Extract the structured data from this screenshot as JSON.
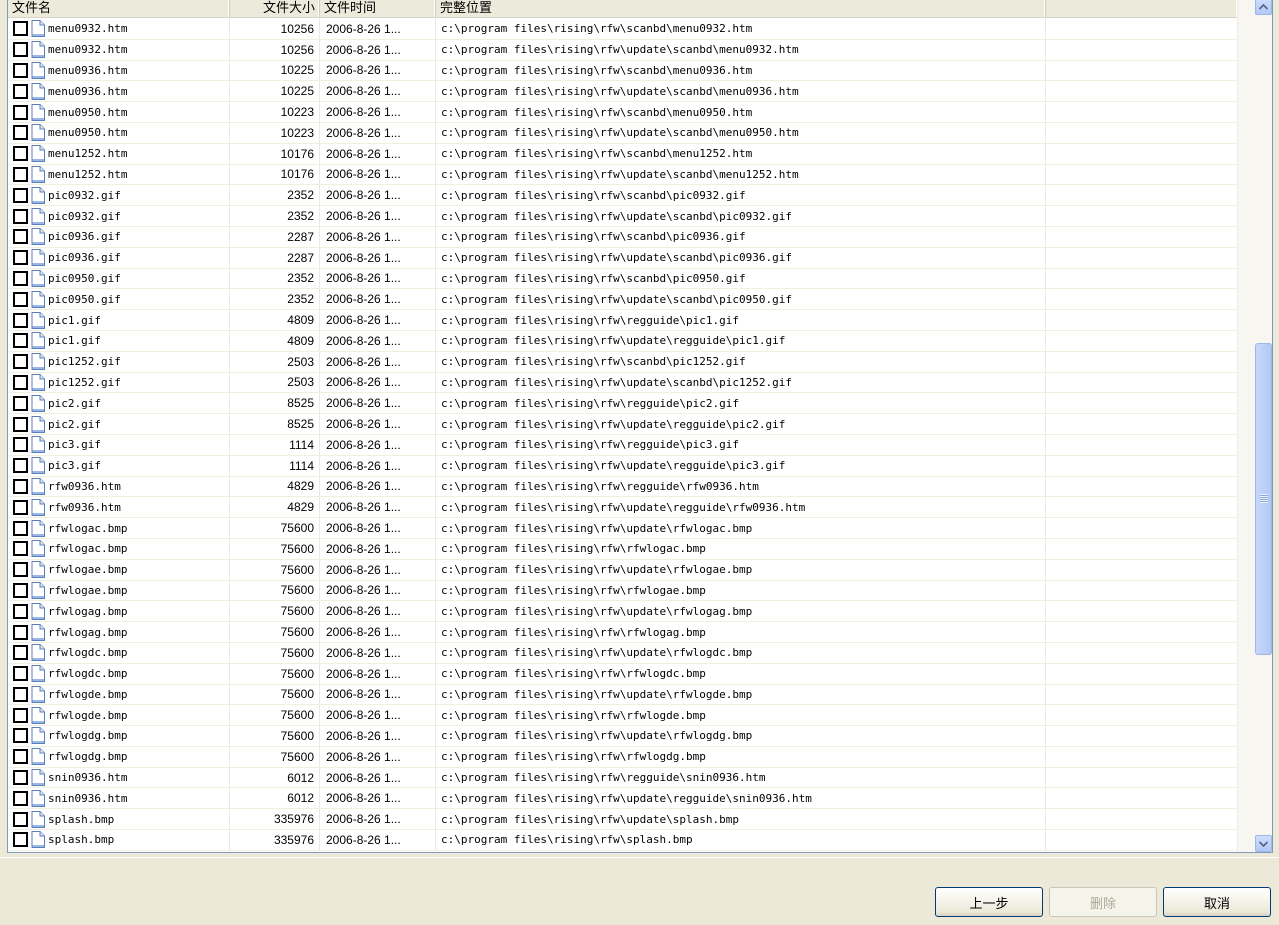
{
  "headers": {
    "name": "文件名",
    "size": "文件大小",
    "time": "文件时间",
    "path": "完整位置"
  },
  "icons": {
    "checkbox": "checkbox-unchecked",
    "file": "file-icon",
    "scroll_up": "scroll-up-arrow-icon",
    "scroll_down": "scroll-down-arrow-icon"
  },
  "rows": [
    {
      "name": "menu0932.htm",
      "size": "10256",
      "time": "2006-8-26 1...",
      "path": "c:\\program files\\rising\\rfw\\scanbd\\menu0932.htm"
    },
    {
      "name": "menu0932.htm",
      "size": "10256",
      "time": "2006-8-26 1...",
      "path": "c:\\program files\\rising\\rfw\\update\\scanbd\\menu0932.htm"
    },
    {
      "name": "menu0936.htm",
      "size": "10225",
      "time": "2006-8-26 1...",
      "path": "c:\\program files\\rising\\rfw\\scanbd\\menu0936.htm"
    },
    {
      "name": "menu0936.htm",
      "size": "10225",
      "time": "2006-8-26 1...",
      "path": "c:\\program files\\rising\\rfw\\update\\scanbd\\menu0936.htm"
    },
    {
      "name": "menu0950.htm",
      "size": "10223",
      "time": "2006-8-26 1...",
      "path": "c:\\program files\\rising\\rfw\\scanbd\\menu0950.htm"
    },
    {
      "name": "menu0950.htm",
      "size": "10223",
      "time": "2006-8-26 1...",
      "path": "c:\\program files\\rising\\rfw\\update\\scanbd\\menu0950.htm"
    },
    {
      "name": "menu1252.htm",
      "size": "10176",
      "time": "2006-8-26 1...",
      "path": "c:\\program files\\rising\\rfw\\scanbd\\menu1252.htm"
    },
    {
      "name": "menu1252.htm",
      "size": "10176",
      "time": "2006-8-26 1...",
      "path": "c:\\program files\\rising\\rfw\\update\\scanbd\\menu1252.htm"
    },
    {
      "name": "pic0932.gif",
      "size": "2352",
      "time": "2006-8-26 1...",
      "path": "c:\\program files\\rising\\rfw\\scanbd\\pic0932.gif"
    },
    {
      "name": "pic0932.gif",
      "size": "2352",
      "time": "2006-8-26 1...",
      "path": "c:\\program files\\rising\\rfw\\update\\scanbd\\pic0932.gif"
    },
    {
      "name": "pic0936.gif",
      "size": "2287",
      "time": "2006-8-26 1...",
      "path": "c:\\program files\\rising\\rfw\\scanbd\\pic0936.gif"
    },
    {
      "name": "pic0936.gif",
      "size": "2287",
      "time": "2006-8-26 1...",
      "path": "c:\\program files\\rising\\rfw\\update\\scanbd\\pic0936.gif"
    },
    {
      "name": "pic0950.gif",
      "size": "2352",
      "time": "2006-8-26 1...",
      "path": "c:\\program files\\rising\\rfw\\scanbd\\pic0950.gif"
    },
    {
      "name": "pic0950.gif",
      "size": "2352",
      "time": "2006-8-26 1...",
      "path": "c:\\program files\\rising\\rfw\\update\\scanbd\\pic0950.gif"
    },
    {
      "name": "pic1.gif",
      "size": "4809",
      "time": "2006-8-26 1...",
      "path": "c:\\program files\\rising\\rfw\\regguide\\pic1.gif"
    },
    {
      "name": "pic1.gif",
      "size": "4809",
      "time": "2006-8-26 1...",
      "path": "c:\\program files\\rising\\rfw\\update\\regguide\\pic1.gif"
    },
    {
      "name": "pic1252.gif",
      "size": "2503",
      "time": "2006-8-26 1...",
      "path": "c:\\program files\\rising\\rfw\\scanbd\\pic1252.gif"
    },
    {
      "name": "pic1252.gif",
      "size": "2503",
      "time": "2006-8-26 1...",
      "path": "c:\\program files\\rising\\rfw\\update\\scanbd\\pic1252.gif"
    },
    {
      "name": "pic2.gif",
      "size": "8525",
      "time": "2006-8-26 1...",
      "path": "c:\\program files\\rising\\rfw\\regguide\\pic2.gif"
    },
    {
      "name": "pic2.gif",
      "size": "8525",
      "time": "2006-8-26 1...",
      "path": "c:\\program files\\rising\\rfw\\update\\regguide\\pic2.gif"
    },
    {
      "name": "pic3.gif",
      "size": "1114",
      "time": "2006-8-26 1...",
      "path": "c:\\program files\\rising\\rfw\\regguide\\pic3.gif"
    },
    {
      "name": "pic3.gif",
      "size": "1114",
      "time": "2006-8-26 1...",
      "path": "c:\\program files\\rising\\rfw\\update\\regguide\\pic3.gif"
    },
    {
      "name": "rfw0936.htm",
      "size": "4829",
      "time": "2006-8-26 1...",
      "path": "c:\\program files\\rising\\rfw\\regguide\\rfw0936.htm"
    },
    {
      "name": "rfw0936.htm",
      "size": "4829",
      "time": "2006-8-26 1...",
      "path": "c:\\program files\\rising\\rfw\\update\\regguide\\rfw0936.htm"
    },
    {
      "name": "rfwlogac.bmp",
      "size": "75600",
      "time": "2006-8-26 1...",
      "path": "c:\\program files\\rising\\rfw\\update\\rfwlogac.bmp"
    },
    {
      "name": "rfwlogac.bmp",
      "size": "75600",
      "time": "2006-8-26 1...",
      "path": "c:\\program files\\rising\\rfw\\rfwlogac.bmp"
    },
    {
      "name": "rfwlogae.bmp",
      "size": "75600",
      "time": "2006-8-26 1...",
      "path": "c:\\program files\\rising\\rfw\\update\\rfwlogae.bmp"
    },
    {
      "name": "rfwlogae.bmp",
      "size": "75600",
      "time": "2006-8-26 1...",
      "path": "c:\\program files\\rising\\rfw\\rfwlogae.bmp"
    },
    {
      "name": "rfwlogag.bmp",
      "size": "75600",
      "time": "2006-8-26 1...",
      "path": "c:\\program files\\rising\\rfw\\update\\rfwlogag.bmp"
    },
    {
      "name": "rfwlogag.bmp",
      "size": "75600",
      "time": "2006-8-26 1...",
      "path": "c:\\program files\\rising\\rfw\\rfwlogag.bmp"
    },
    {
      "name": "rfwlogdc.bmp",
      "size": "75600",
      "time": "2006-8-26 1...",
      "path": "c:\\program files\\rising\\rfw\\update\\rfwlogdc.bmp"
    },
    {
      "name": "rfwlogdc.bmp",
      "size": "75600",
      "time": "2006-8-26 1...",
      "path": "c:\\program files\\rising\\rfw\\rfwlogdc.bmp"
    },
    {
      "name": "rfwlogde.bmp",
      "size": "75600",
      "time": "2006-8-26 1...",
      "path": "c:\\program files\\rising\\rfw\\update\\rfwlogde.bmp"
    },
    {
      "name": "rfwlogde.bmp",
      "size": "75600",
      "time": "2006-8-26 1...",
      "path": "c:\\program files\\rising\\rfw\\rfwlogde.bmp"
    },
    {
      "name": "rfwlogdg.bmp",
      "size": "75600",
      "time": "2006-8-26 1...",
      "path": "c:\\program files\\rising\\rfw\\update\\rfwlogdg.bmp"
    },
    {
      "name": "rfwlogdg.bmp",
      "size": "75600",
      "time": "2006-8-26 1...",
      "path": "c:\\program files\\rising\\rfw\\rfwlogdg.bmp"
    },
    {
      "name": "snin0936.htm",
      "size": "6012",
      "time": "2006-8-26 1...",
      "path": "c:\\program files\\rising\\rfw\\regguide\\snin0936.htm"
    },
    {
      "name": "snin0936.htm",
      "size": "6012",
      "time": "2006-8-26 1...",
      "path": "c:\\program files\\rising\\rfw\\update\\regguide\\snin0936.htm"
    },
    {
      "name": "splash.bmp",
      "size": "335976",
      "time": "2006-8-26 1...",
      "path": "c:\\program files\\rising\\rfw\\update\\splash.bmp"
    },
    {
      "name": "splash.bmp",
      "size": "335976",
      "time": "2006-8-26 1...",
      "path": "c:\\program files\\rising\\rfw\\splash.bmp"
    }
  ],
  "buttons": {
    "back": "上一步",
    "delete": "删除",
    "cancel": "取消"
  },
  "colors": {
    "dialog_bg": "#ece9d8",
    "border": "#7f9db9",
    "scroll_blue": "#b1c9f6",
    "button_border": "#003c74"
  }
}
